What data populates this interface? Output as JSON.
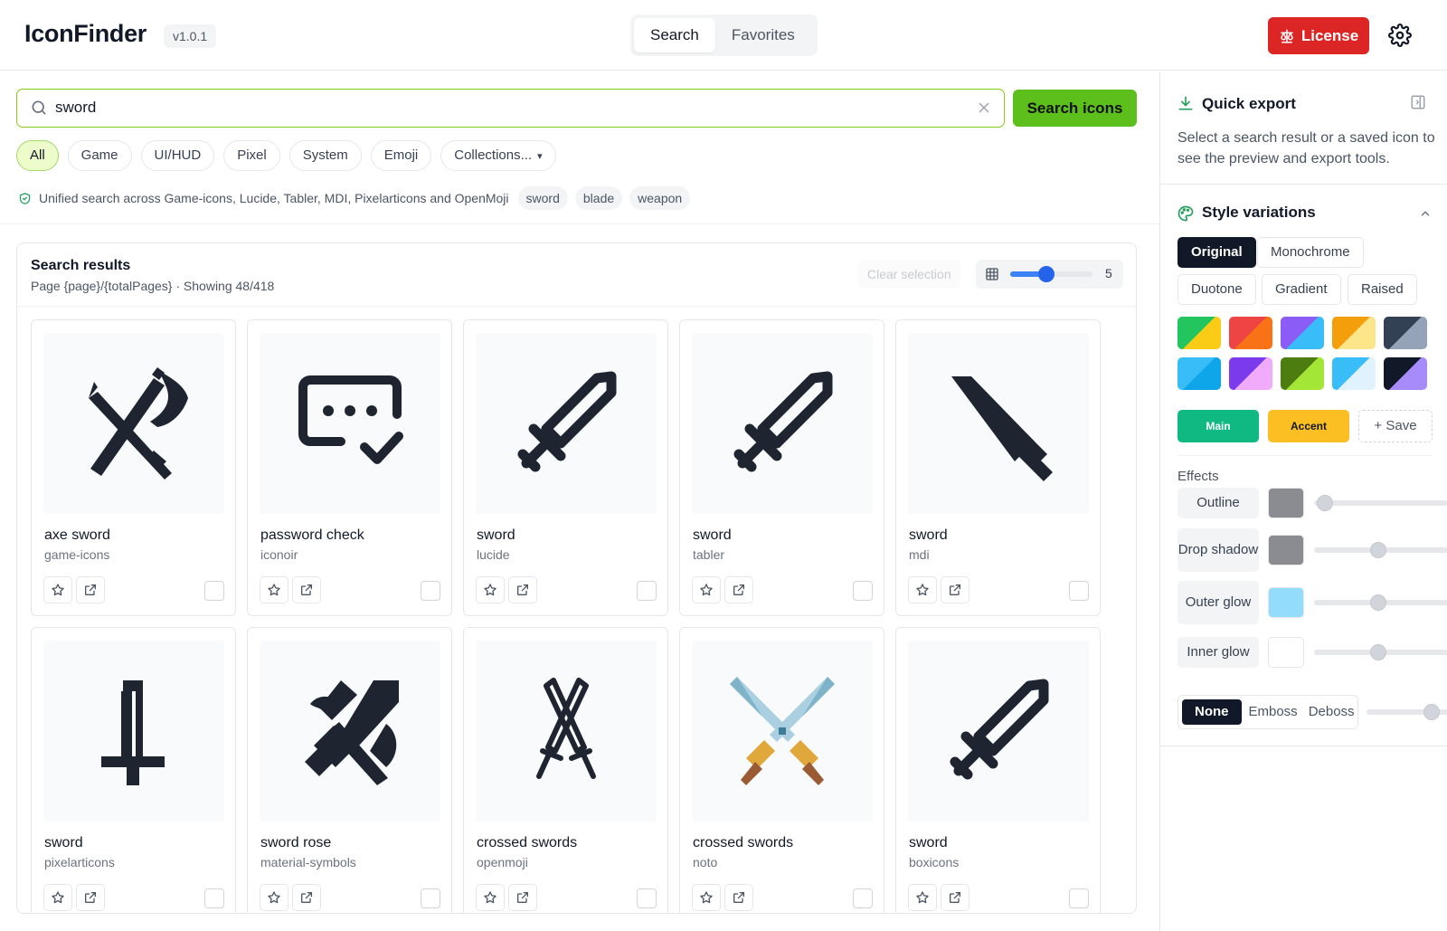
{
  "app": {
    "name": "IconFinder",
    "version": "v1.0.1"
  },
  "nav": {
    "tabs": [
      {
        "label": "Search",
        "active": true
      },
      {
        "label": "Favorites",
        "active": false
      }
    ]
  },
  "header": {
    "license_label": "License"
  },
  "search": {
    "query": "sword",
    "button_label": "Search icons"
  },
  "filters": [
    {
      "label": "All",
      "active": true
    },
    {
      "label": "Game",
      "active": false
    },
    {
      "label": "UI/HUD",
      "active": false
    },
    {
      "label": "Pixel",
      "active": false
    },
    {
      "label": "System",
      "active": false
    },
    {
      "label": "Emoji",
      "active": false
    },
    {
      "label": "Collections...",
      "active": false
    }
  ],
  "search_info": {
    "text": "Unified search across Game-icons, Lucide, Tabler, MDI, Pixelarticons and OpenMoji",
    "tags": [
      "sword",
      "blade",
      "weapon"
    ]
  },
  "results": {
    "title": "Search results",
    "subtitle": "Page {page}/{totalPages} · Showing 48/418",
    "clear_selection_label": "Clear selection",
    "grid_size": 5,
    "grid_min": 1,
    "grid_max": 10,
    "items": [
      {
        "name": "axe sword",
        "source": "game-icons",
        "icon": "axe-sword-icon"
      },
      {
        "name": "password check",
        "source": "iconoir",
        "icon": "password-check-icon"
      },
      {
        "name": "sword",
        "source": "lucide",
        "icon": "sword-icon"
      },
      {
        "name": "sword",
        "source": "tabler",
        "icon": "sword-icon"
      },
      {
        "name": "sword",
        "source": "mdi",
        "icon": "sword-icon"
      },
      {
        "name": "sword",
        "source": "pixelarticons",
        "icon": "pixel-sword-icon"
      },
      {
        "name": "sword rose",
        "source": "material-symbols",
        "icon": "sword-rose-icon"
      },
      {
        "name": "crossed swords",
        "source": "openmoji",
        "icon": "crossed-swords-icon"
      },
      {
        "name": "crossed swords",
        "source": "noto",
        "icon": "crossed-swords-icon"
      },
      {
        "name": "sword",
        "source": "boxicons",
        "icon": "sword-icon"
      }
    ]
  },
  "quick_export": {
    "title": "Quick export",
    "text": "Select a search result or a saved icon to see the preview and export tools."
  },
  "style_variations": {
    "title": "Style variations",
    "styles": [
      {
        "label": "Original",
        "active": true
      },
      {
        "label": "Monochrome",
        "active": false
      },
      {
        "label": "Duotone",
        "active": false
      },
      {
        "label": "Gradient",
        "active": false
      },
      {
        "label": "Raised",
        "active": false
      }
    ],
    "palettes": [
      [
        "#22c55e",
        "#facc15"
      ],
      [
        "#ef4444",
        "#f97316"
      ],
      [
        "#8b5cf6",
        "#38bdf8"
      ],
      [
        "#f59e0b",
        "#fde68a"
      ],
      [
        "#334155",
        "#94a3b8"
      ],
      [
        "#38bdf8",
        "#0ea5e9"
      ],
      [
        "#7c3aed",
        "#f0abfc"
      ],
      [
        "#4d7c0f",
        "#a3e635"
      ],
      [
        "#38bdf8",
        "#e0f2fe"
      ],
      [
        "#111827",
        "#a78bfa"
      ]
    ],
    "main_label": "Main",
    "main_color": "#10b981",
    "accent_label": "Accent",
    "accent_color": "#fbbf24",
    "save_label": "Save"
  },
  "effects": {
    "label": "Effects",
    "items": [
      {
        "label": "Outline",
        "color": "#8b8c92",
        "level": 0.08
      },
      {
        "label": "Drop shadow",
        "color": "#8b8c92",
        "level": 0.48
      },
      {
        "label": "Outer glow",
        "color": "#93dcfb",
        "level": 0.48
      },
      {
        "label": "Inner glow",
        "color": "#ffffff",
        "level": 0.48
      }
    ],
    "emboss": {
      "options": [
        "None",
        "Emboss",
        "Deboss"
      ],
      "selected": "None",
      "level": 0.8
    }
  },
  "colors": {
    "accent": "#5cbf1c",
    "license": "#dc2626",
    "dark": "#111827"
  }
}
